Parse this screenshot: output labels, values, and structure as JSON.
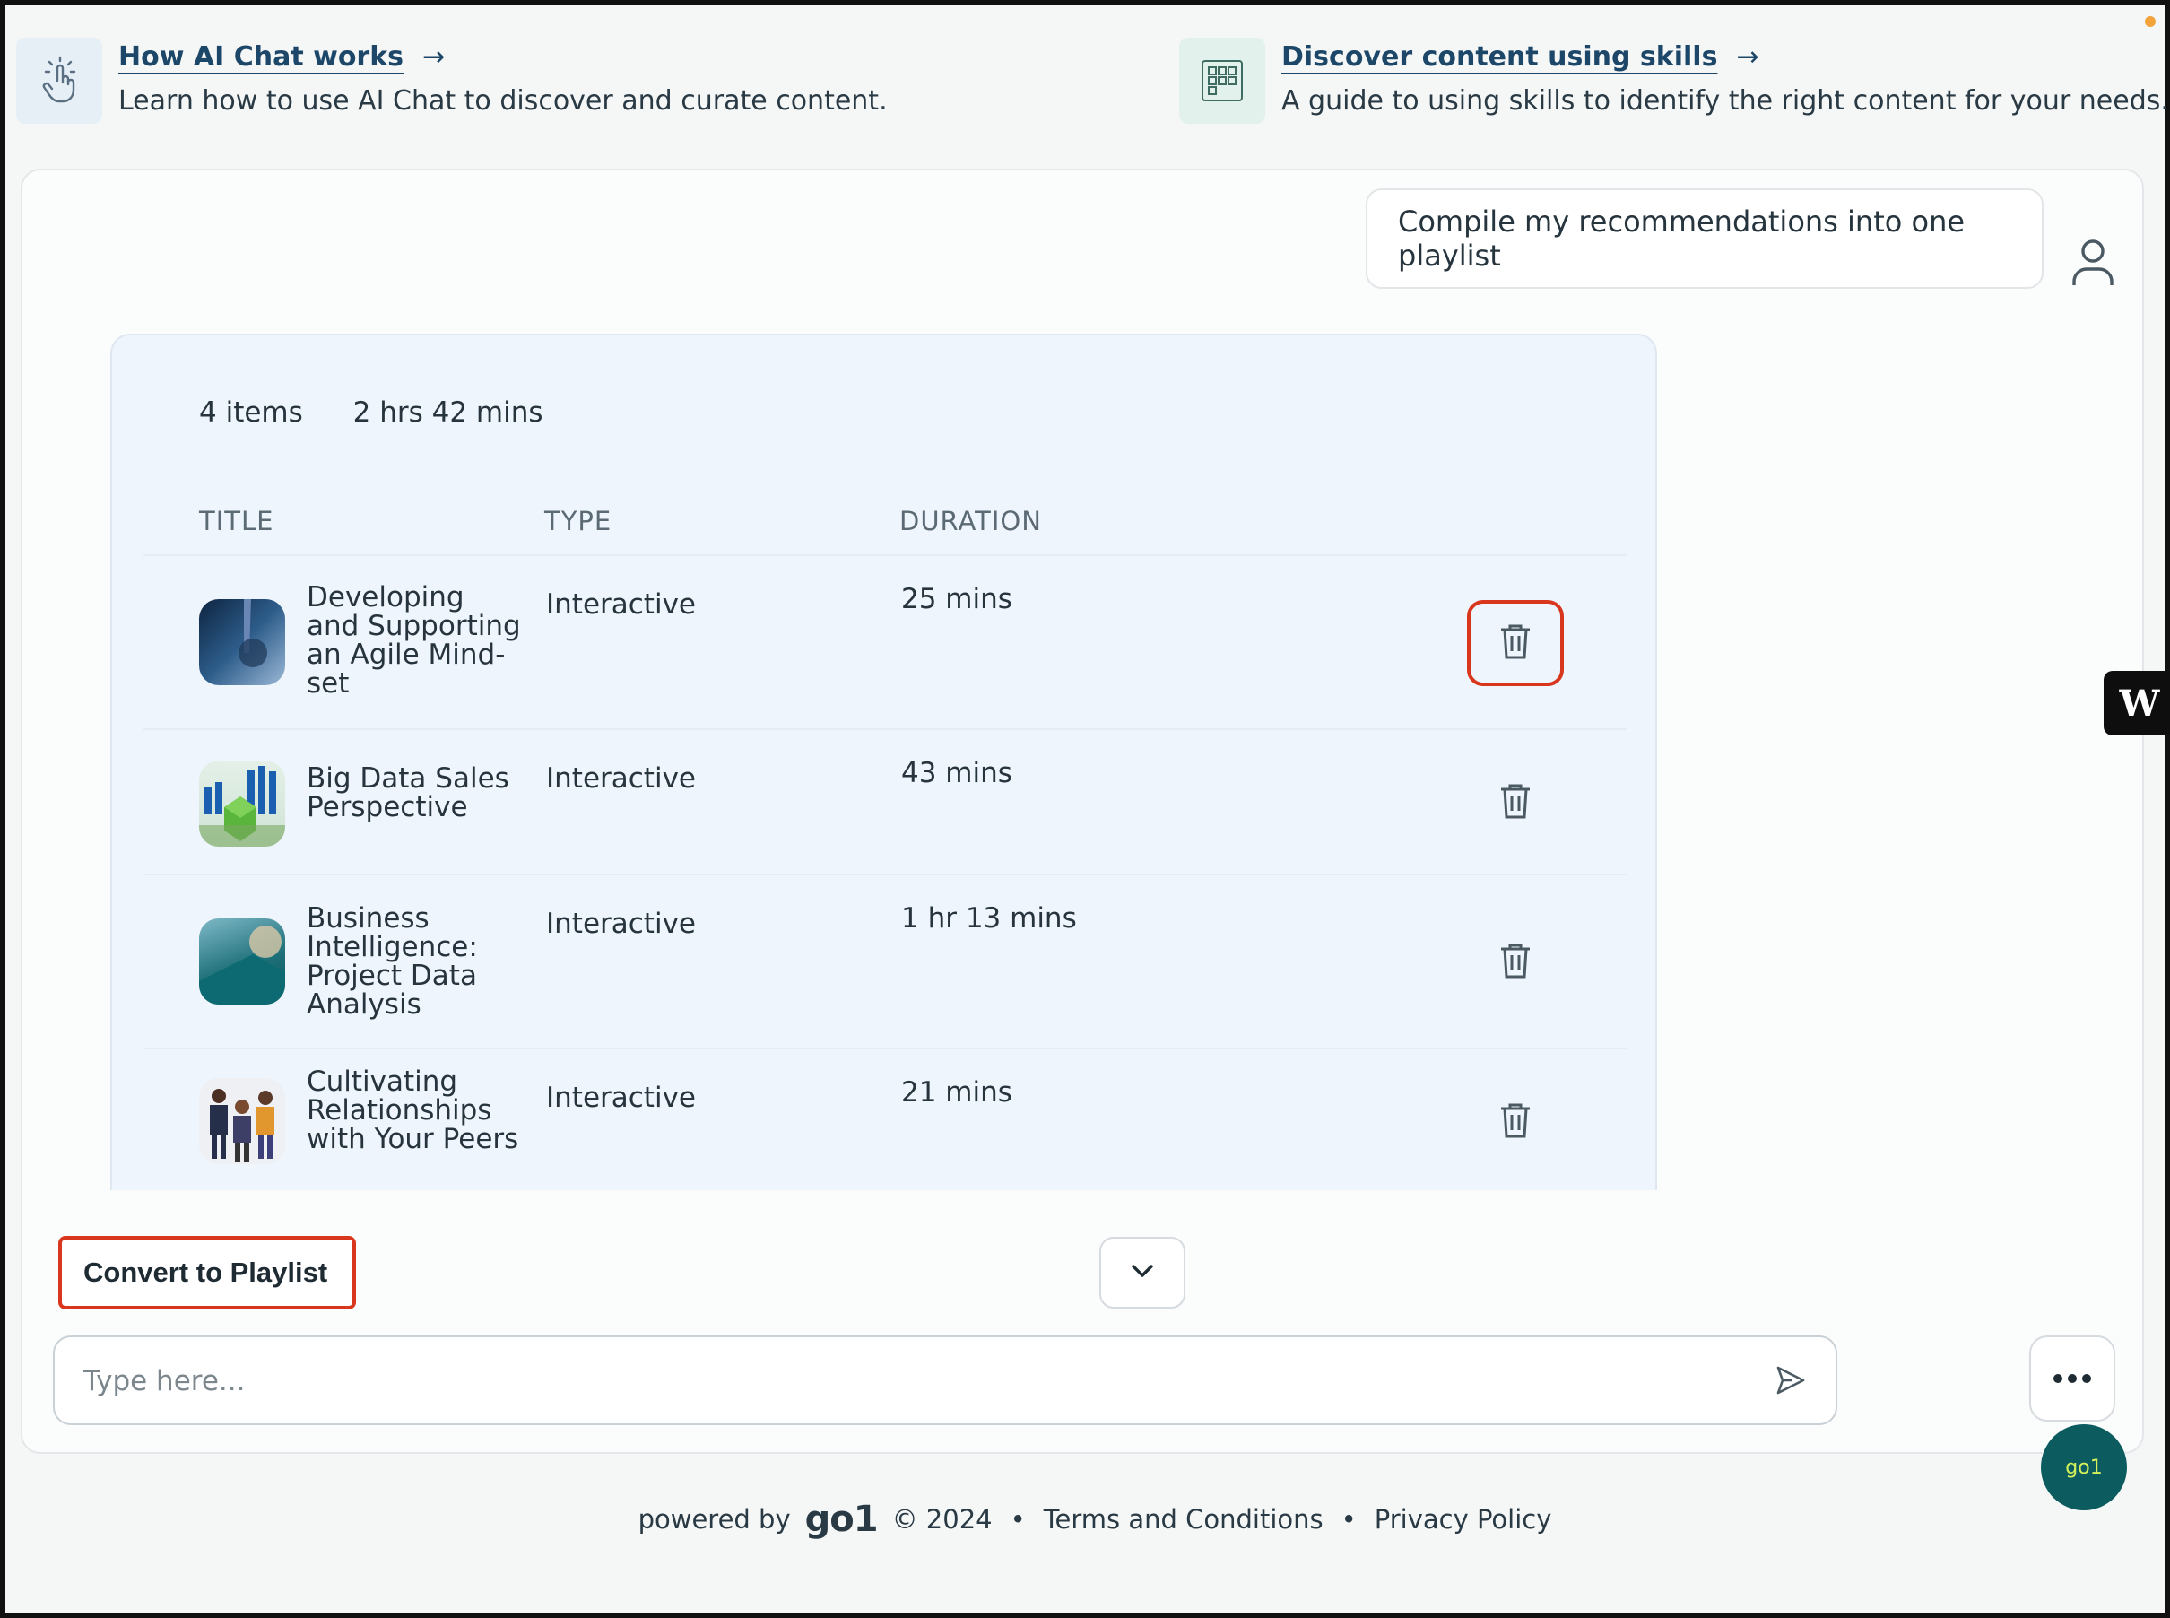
{
  "guides": [
    {
      "title": "How AI Chat works",
      "arrow": "→",
      "desc": "Learn how to use AI Chat to discover and curate content."
    },
    {
      "title": "Discover content using skills",
      "arrow": "→",
      "desc": "A guide to using skills to identify the right content for your needs."
    }
  ],
  "chat": {
    "user_message": "Compile my recommendations into one playlist"
  },
  "recommendations": {
    "item_count": "4 items",
    "total_duration": "2 hrs 42 mins",
    "columns": {
      "title": "TITLE",
      "type": "TYPE",
      "duration": "DURATION"
    },
    "items": [
      {
        "title": "Developing and Supporting an Agile Mind-set",
        "type": "Interactive",
        "duration": "25 mins"
      },
      {
        "title": "Big Data Sales Perspective",
        "type": "Interactive",
        "duration": "43 mins"
      },
      {
        "title": "Business Intelligence: Project Data Analysis",
        "type": "Interactive",
        "duration": "1 hr 13 mins"
      },
      {
        "title": "Cultivating Relationships with Your Peers",
        "type": "Interactive",
        "duration": "21 mins"
      }
    ]
  },
  "actions": {
    "convert_label": "Convert to Playlist"
  },
  "composer": {
    "placeholder": "Type here..."
  },
  "badges": {
    "w_label": "W",
    "go1_label": "go1"
  },
  "footer": {
    "powered_by": "powered by",
    "logo": "go1",
    "copyright": "© 2024",
    "bullet": "•",
    "terms": "Terms and Conditions",
    "privacy": "Privacy Policy"
  },
  "colors": {
    "highlight": "#d9361e",
    "link": "#1d4768",
    "card_bg": "#eef5fc"
  }
}
